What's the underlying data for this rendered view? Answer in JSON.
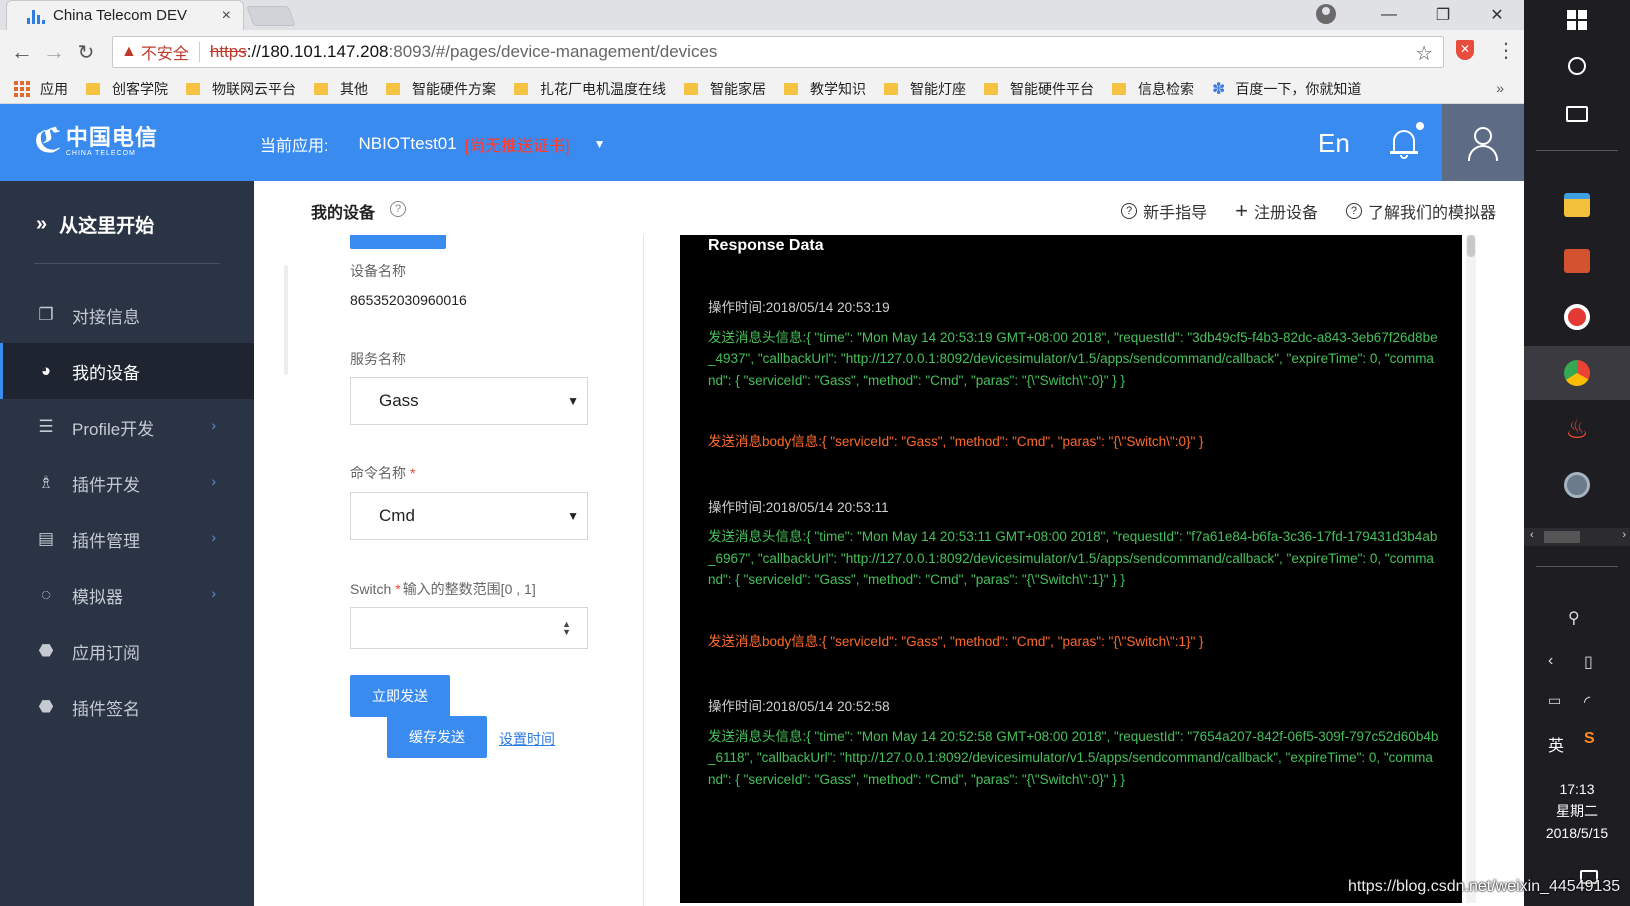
{
  "browser": {
    "tab_title": "China Telecom DEV",
    "tab_close": "×",
    "window_controls": {
      "minimize": "—",
      "restore": "❐",
      "close": "✕"
    },
    "address": {
      "warning_icon": "▲",
      "insecure_label": "不安全",
      "url_scheme": "https",
      "url_host": "://180.101.147.208",
      "url_rest": ":8093/#/pages/device-management/devices"
    },
    "bookmarks": [
      "应用",
      "创客学院",
      "物联网云平台",
      "其他",
      "智能硬件方案",
      "扎花厂电机温度在线",
      "智能家居",
      "教学知识",
      "智能灯座",
      "智能硬件平台",
      "信息检索",
      "百度一下，你就知道"
    ],
    "bookmarks_more": "»"
  },
  "header": {
    "logo_cn": "中国电信",
    "logo_en": "CHINA TELECOM",
    "current_app_label": "当前应用:",
    "current_app_name": "NBIOTtest01",
    "current_app_warning": "[尚无推送证书]",
    "lang_toggle": "En",
    "colors": {
      "header_bg": "#3a8bf0",
      "warning": "#ff3b30"
    }
  },
  "sidebar": {
    "start_label": "从这里开始",
    "items": [
      {
        "label": "对接信息",
        "icon": "window-icon"
      },
      {
        "label": "我的设备",
        "icon": "device-icon",
        "active": true
      },
      {
        "label": "Profile开发",
        "icon": "list-icon",
        "arrow": "›"
      },
      {
        "label": "插件开发",
        "icon": "hierarchy-icon",
        "arrow": "›"
      },
      {
        "label": "插件管理",
        "icon": "panel-icon",
        "arrow": "›"
      },
      {
        "label": "模拟器",
        "icon": "simulator-icon",
        "arrow": "›"
      },
      {
        "label": "应用订阅",
        "icon": "subscribe-icon"
      },
      {
        "label": "插件签名",
        "icon": "signature-icon"
      }
    ]
  },
  "main": {
    "page_title": "我的设备",
    "actions": [
      "新手指导",
      "注册设备",
      "了解我们的模拟器"
    ]
  },
  "form": {
    "device_name_label": "设备名称",
    "device_name_value": "865352030960016",
    "service_name_label": "服务名称",
    "service_name_value": "Gass",
    "command_name_label": "命令名称",
    "command_required": "*",
    "command_name_value": "Cmd",
    "switch_label": "Switch",
    "switch_required": "*",
    "switch_hint": "输入的整数范围[0 , 1]",
    "switch_value": "",
    "send_now": "立即发送",
    "cache_send": "缓存发送",
    "set_time": "设置时间"
  },
  "response": {
    "title": "Response Data",
    "logs": [
      {
        "time": "操作时间:2018/05/14 20:53:19",
        "head": "发送消息头信息:{ \"time\": \"Mon May 14 20:53:19 GMT+08:00 2018\", \"requestId\": \"3db49cf5-f4b3-82dc-a843-3eb67f26d8be_4937\", \"callbackUrl\": \"http://127.0.0.1:8092/devicesimulator/v1.5/apps/sendcommand/callback\", \"expireTime\": 0, \"command\": { \"serviceId\": \"Gass\", \"method\": \"Cmd\", \"paras\": \"{\\\"Switch\\\":0}\" } }",
        "body": "发送消息body信息:{ \"serviceId\": \"Gass\", \"method\": \"Cmd\", \"paras\": \"{\\\"Switch\\\":0}\" }"
      },
      {
        "time": "操作时间:2018/05/14 20:53:11",
        "head": "发送消息头信息:{ \"time\": \"Mon May 14 20:53:11 GMT+08:00 2018\", \"requestId\": \"f7a61e84-b6fa-3c36-17fd-179431d3b4ab_6967\", \"callbackUrl\": \"http://127.0.0.1:8092/devicesimulator/v1.5/apps/sendcommand/callback\", \"expireTime\": 0, \"command\": { \"serviceId\": \"Gass\", \"method\": \"Cmd\", \"paras\": \"{\\\"Switch\\\":1}\" } }",
        "body": "发送消息body信息:{ \"serviceId\": \"Gass\", \"method\": \"Cmd\", \"paras\": \"{\\\"Switch\\\":1}\" }"
      },
      {
        "time": "操作时间:2018/05/14 20:52:58",
        "head": "发送消息头信息:{ \"time\": \"Mon May 14 20:52:58 GMT+08:00 2018\", \"requestId\": \"7654a207-842f-06f5-309f-797c52d60b4b_6118\", \"callbackUrl\": \"http://127.0.0.1:8092/devicesimulator/v1.5/apps/sendcommand/callback\", \"expireTime\": 0, \"command\": { \"serviceId\": \"Gass\", \"method\": \"Cmd\", \"paras\": \"{\\\"Switch\\\":0}\" } }"
      }
    ],
    "colors": {
      "time": "#cfcfcf",
      "head": "#46c05b",
      "body": "#ff6a2a"
    }
  },
  "taskbar": {
    "ime_label": "英",
    "time": "17:13",
    "weekday": "星期二",
    "date": "2018/5/15"
  },
  "watermark": "https://blog.csdn.net/weixin_44549135"
}
